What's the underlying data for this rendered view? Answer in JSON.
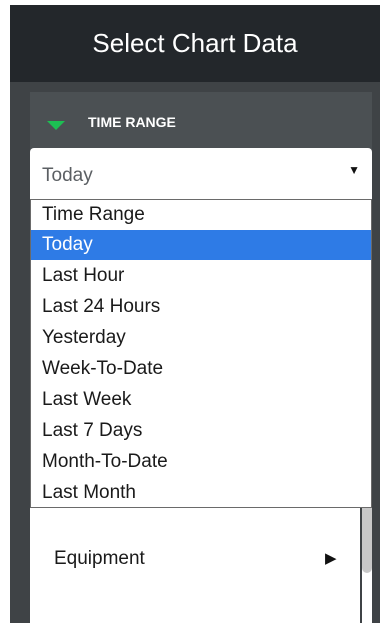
{
  "header": {
    "title": "Select Chart Data"
  },
  "section": {
    "label": "TIME RANGE"
  },
  "select": {
    "value": "Today",
    "options": [
      "Time Range",
      "Today",
      "Last Hour",
      "Last 24 Hours",
      "Yesterday",
      "Week-To-Date",
      "Last Week",
      "Last 7 Days",
      "Month-To-Date",
      "Last Month"
    ],
    "selected_option": "Today"
  },
  "menu": {
    "equipment_label": "Equipment"
  },
  "colors": {
    "accent": "#1dbf53",
    "selected": "#2e7be6",
    "header_bg": "#23272b",
    "panel_bg": "#3f4346"
  },
  "icons": {
    "section_toggle": "triangle-down-icon",
    "select_arrow": "caret-down-icon",
    "submenu_arrow": "chevron-right-icon"
  }
}
